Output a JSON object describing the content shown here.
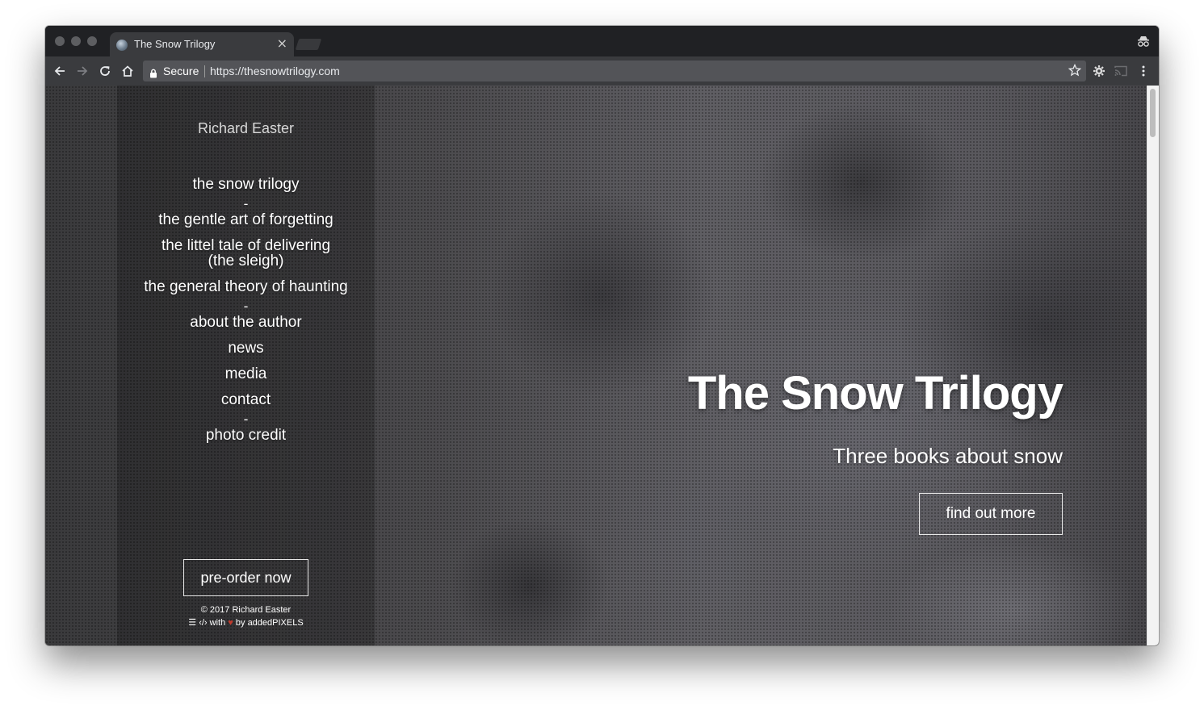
{
  "browser": {
    "tab_title": "The Snow Trilogy",
    "tab_close": "×",
    "secure_label": "Secure",
    "url": "https://thesnowtrilogy.com"
  },
  "sidebar": {
    "author_name": "Richard Easter",
    "nav": [
      {
        "label": "the snow trilogy"
      },
      {
        "label": "-"
      },
      {
        "label": "the gentle art of forgetting"
      },
      {
        "label": "the littel tale of delivering"
      },
      {
        "label": "(the sleigh)"
      },
      {
        "label": "the general theory of haunting"
      },
      {
        "label": "-"
      },
      {
        "label": "about the author"
      },
      {
        "label": "news"
      },
      {
        "label": "media"
      },
      {
        "label": "contact"
      },
      {
        "label": "-"
      },
      {
        "label": "photo credit"
      }
    ],
    "preorder_label": "pre-order now",
    "copyright": "© 2017 Richard Easter",
    "built_with": "with",
    "built_by": "by addedPIXELS"
  },
  "hero": {
    "title": "The Snow Trilogy",
    "subtitle": "Three books about snow",
    "cta_label": "find out more"
  },
  "colors": {
    "chrome_dark": "#202124",
    "chrome_toolbar": "#3a3b3e",
    "heart": "#c0392b"
  }
}
